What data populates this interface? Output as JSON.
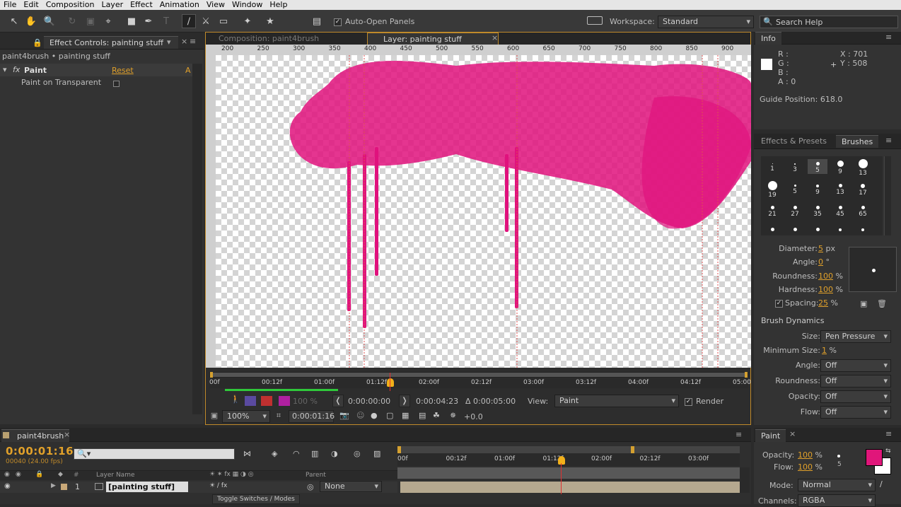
{
  "menu": [
    "File",
    "Edit",
    "Composition",
    "Layer",
    "Effect",
    "Animation",
    "View",
    "Window",
    "Help"
  ],
  "toolbar": {
    "auto_open": "Auto-Open Panels",
    "workspace_label": "Workspace:",
    "workspace": "Standard",
    "search_placeholder": "Search Help"
  },
  "effect_controls": {
    "tab": "Effect Controls: painting stuff",
    "subtitle": "paint4brush • painting stuff",
    "effect_name": "Paint",
    "reset": "Reset",
    "about": "A",
    "option": "Paint on Transparent"
  },
  "viewer": {
    "comp_tab": "Composition: paint4brush",
    "layer_tab": "Layer: painting stuff",
    "ruler": [
      "200",
      "250",
      "300",
      "350",
      "400",
      "450",
      "500",
      "550",
      "600",
      "650",
      "700",
      "750",
      "800",
      "850",
      "900"
    ],
    "timeline_ticks": [
      "00f",
      "00:12f",
      "01:00f",
      "01:12f",
      "02:00f",
      "02:12f",
      "03:00f",
      "03:12f",
      "04:00f",
      "04:12f",
      "05:00"
    ],
    "zoom_pct": "100 %",
    "start": "0:00:00:00",
    "end": "0:00:04:23",
    "delta": "Δ 0:00:05:00",
    "view_label": "View:",
    "view": "Paint",
    "render": "Render",
    "zoom": "100%",
    "current": "0:00:01:16",
    "exposure": "+0.0"
  },
  "info": {
    "tab": "Info",
    "r": "R :",
    "g": "G :",
    "b": "B :",
    "a": "A : 0",
    "x": "X : 701",
    "y": "Y : 508",
    "guide": "Guide Position: 618.0"
  },
  "brushes": {
    "tab1": "Effects & Presets",
    "tab2": "Brushes",
    "grid": [
      {
        "s": 1,
        "l": "1"
      },
      {
        "s": 2,
        "l": "3"
      },
      {
        "s": 5,
        "l": "5"
      },
      {
        "s": 9,
        "l": "9"
      },
      {
        "s": 13,
        "l": "13"
      },
      {
        "s": 13,
        "l": "19"
      },
      {
        "s": 3,
        "l": "5"
      },
      {
        "s": 4,
        "l": "9"
      },
      {
        "s": 5,
        "l": "13"
      },
      {
        "s": 6,
        "l": "17"
      },
      {
        "s": 5,
        "l": "21"
      },
      {
        "s": 5,
        "l": "27"
      },
      {
        "s": 5,
        "l": "35"
      },
      {
        "s": 5,
        "l": "45"
      },
      {
        "s": 5,
        "l": "65"
      },
      {
        "s": 5,
        "l": ""
      },
      {
        "s": 5,
        "l": ""
      },
      {
        "s": 5,
        "l": ""
      },
      {
        "s": 4,
        "l": ""
      },
      {
        "s": 4,
        "l": ""
      }
    ],
    "diameter_l": "Diameter:",
    "diameter": "5",
    "diameter_u": "px",
    "angle_l": "Angle:",
    "angle": "0",
    "angle_u": "°",
    "round_l": "Roundness:",
    "round": "100",
    "round_u": "%",
    "hard_l": "Hardness:",
    "hard": "100",
    "hard_u": "%",
    "spacing_l": "Spacing:",
    "spacing": "25",
    "spacing_u": "%",
    "dynamics": "Brush Dynamics",
    "size_l": "Size:",
    "size": "Pen Pressure",
    "minsize_l": "Minimum Size:",
    "minsize": "1",
    "minsize_u": "%",
    "dangle_l": "Angle:",
    "dangle": "Off",
    "dround_l": "Roundness:",
    "dround": "Off",
    "dopac_l": "Opacity:",
    "dopac": "Off",
    "flow_l": "Flow:",
    "flow": "Off"
  },
  "timeline": {
    "tab": "paint4brush",
    "time": "0:00:01:16",
    "frames": "00040 (24.00 fps)",
    "col_layer": "Layer Name",
    "col_parent": "Parent",
    "layer_num": "1",
    "layer_name": "[painting stuff]",
    "parent": "None",
    "toggle": "Toggle Switches / Modes",
    "ticks": [
      "00f",
      "00:12f",
      "01:00f",
      "01:12f",
      "02:00f",
      "02:12f",
      "03:00f"
    ]
  },
  "paint": {
    "tab": "Paint",
    "opacity_l": "Opacity:",
    "opacity": "100",
    "flow_l": "Flow:",
    "flow": "100",
    "pct": "%",
    "size": "5",
    "mode_l": "Mode:",
    "mode": "Normal",
    "channels_l": "Channels:",
    "channels": "RGBA",
    "fg": "#e0167a"
  }
}
